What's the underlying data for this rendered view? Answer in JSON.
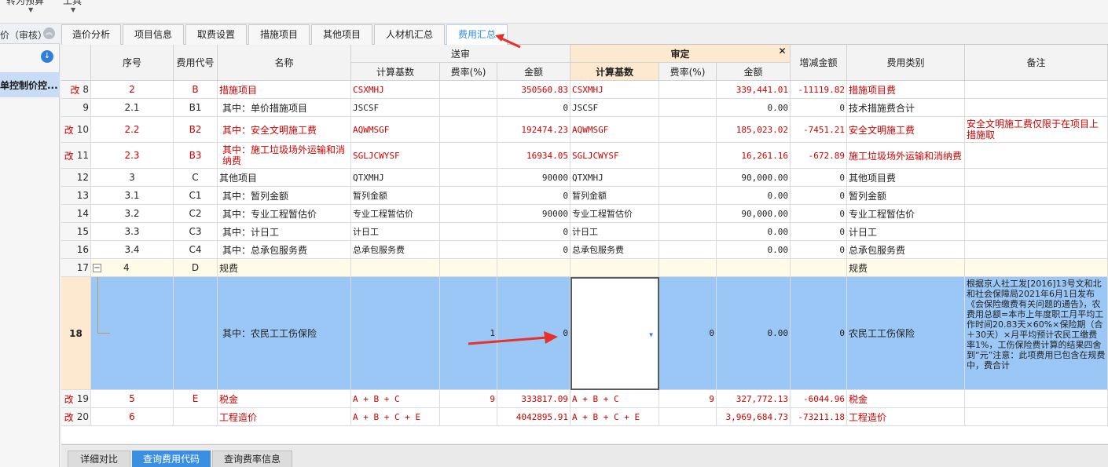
{
  "toolbar": {
    "btn1_label": "转为预算",
    "btn2_label": "工具"
  },
  "left_panel": {
    "header": "价（审核）",
    "item": "单控制价控..."
  },
  "tabs": [
    {
      "label": "造价分析"
    },
    {
      "label": "项目信息"
    },
    {
      "label": "取费设置"
    },
    {
      "label": "措施项目"
    },
    {
      "label": "其他项目"
    },
    {
      "label": "人材机汇总"
    },
    {
      "label": "费用汇总"
    }
  ],
  "grid": {
    "headers": {
      "seq": "序号",
      "code": "费用代号",
      "name": "名称",
      "songshen": "送审",
      "shending": "审定",
      "base": "计算基数",
      "rate": "费率(%)",
      "amount": "金额",
      "diff": "增减金额",
      "category": "费用类别",
      "remark": "备注",
      "close": "✕"
    },
    "modified_mark": "改",
    "rows": [
      {
        "rownum": "8",
        "mod": true,
        "seq": "2",
        "code": "B",
        "name": "措施项目",
        "s_base": "CSXMHJ",
        "s_rate": "",
        "s_amount": "350560.83",
        "d_base": "CSXMHJ",
        "d_rate": "",
        "d_amount": "339,441.01",
        "diff": "-11119.82",
        "category": "措施项目费",
        "remark": ""
      },
      {
        "rownum": "9",
        "mod": false,
        "seq": "2.1",
        "code": "B1",
        "name": "其中：单价措施项目",
        "s_base": "JSCSF",
        "s_rate": "",
        "s_amount": "0",
        "d_base": "JSCSF",
        "d_rate": "",
        "d_amount": "0.00",
        "diff": "0",
        "category": "技术措施费合计",
        "remark": ""
      },
      {
        "rownum": "10",
        "mod": true,
        "seq": "2.2",
        "code": "B2",
        "name": "其中：安全文明施工费",
        "s_base": "AQWMSGF",
        "s_rate": "",
        "s_amount": "192474.23",
        "d_base": "AQWMSGF",
        "d_rate": "",
        "d_amount": "185,023.02",
        "diff": "-7451.21",
        "category": "安全文明施工费",
        "remark": "安全文明施工费仅限于在项目上措施取"
      },
      {
        "rownum": "11",
        "mod": true,
        "seq": "2.3",
        "code": "B3",
        "name": "其中：施工垃圾场外运输和消纳费",
        "s_base": "SGLJCWYSF",
        "s_rate": "",
        "s_amount": "16934.05",
        "d_base": "SGLJCWYSF",
        "d_rate": "",
        "d_amount": "16,261.16",
        "diff": "-672.89",
        "category": "施工垃圾场外运输和消纳费",
        "remark": ""
      },
      {
        "rownum": "12",
        "mod": false,
        "seq": "3",
        "code": "C",
        "name": "其他项目",
        "s_base": "QTXMHJ",
        "s_rate": "",
        "s_amount": "90000",
        "d_base": "QTXMHJ",
        "d_rate": "",
        "d_amount": "90,000.00",
        "diff": "0",
        "category": "其他项目费",
        "remark": ""
      },
      {
        "rownum": "13",
        "mod": false,
        "seq": "3.1",
        "code": "C1",
        "name": "其中：暂列金额",
        "s_base": "暂列金额",
        "s_rate": "",
        "s_amount": "0",
        "d_base": "暂列金额",
        "d_rate": "",
        "d_amount": "0.00",
        "diff": "0",
        "category": "暂列金额",
        "remark": ""
      },
      {
        "rownum": "14",
        "mod": false,
        "seq": "3.2",
        "code": "C2",
        "name": "其中：专业工程暂估价",
        "s_base": "专业工程暂估价",
        "s_rate": "",
        "s_amount": "90000",
        "d_base": "专业工程暂估价",
        "d_rate": "",
        "d_amount": "90,000.00",
        "diff": "0",
        "category": "专业工程暂估价",
        "remark": ""
      },
      {
        "rownum": "15",
        "mod": false,
        "seq": "3.3",
        "code": "C3",
        "name": "其中：计日工",
        "s_base": "计日工",
        "s_rate": "",
        "s_amount": "0",
        "d_base": "计日工",
        "d_rate": "",
        "d_amount": "0.00",
        "diff": "0",
        "category": "计日工",
        "remark": ""
      },
      {
        "rownum": "16",
        "mod": false,
        "seq": "3.4",
        "code": "C4",
        "name": "其中：总承包服务费",
        "s_base": "总承包服务费",
        "s_rate": "",
        "s_amount": "0",
        "d_base": "总承包服务费",
        "d_rate": "",
        "d_amount": "0.00",
        "diff": "0",
        "category": "总承包服务费",
        "remark": ""
      },
      {
        "rownum": "17",
        "mod": false,
        "seq": "4",
        "code": "D",
        "name": "规费",
        "s_base": "",
        "s_rate": "",
        "s_amount": "",
        "d_base": "",
        "d_rate": "",
        "d_amount": "",
        "diff": "",
        "category": "规费",
        "remark": ""
      },
      {
        "rownum": "18",
        "mod": false,
        "seq": "",
        "code": "",
        "name": "其中：农民工工伤保险",
        "s_base": "",
        "s_rate": "1",
        "s_amount": "0",
        "d_base": "",
        "d_rate": "0",
        "d_amount": "0.00",
        "diff": "0",
        "category": "农民工工伤保险",
        "remark": "根据京人社工发[2016]13号文和北和社会保障局2021年6月1日发布《会保险缴费有关问题的通告》，农费用总额=本市上年度职工月平均工作时间20.83天×60%×保险期（合＋30天）×月平均预计农民工缴费率1%，工伤保险费计算的结果四舍到“元”注意：此项费用已包含在规费中，费合计"
      },
      {
        "rownum": "19",
        "mod": true,
        "seq": "5",
        "code": "E",
        "name": "税金",
        "s_base": "A + B + C",
        "s_rate": "9",
        "s_amount": "333817.09",
        "d_base": "A + B + C",
        "d_rate": "9",
        "d_amount": "327,772.13",
        "diff": "-6044.96",
        "category": "税金",
        "remark": ""
      },
      {
        "rownum": "20",
        "mod": true,
        "seq": "6",
        "code": "",
        "name": "工程造价",
        "s_base": "A + B + C + E",
        "s_rate": "",
        "s_amount": "4042895.91",
        "d_base": "A + B + C + E",
        "d_rate": "",
        "d_amount": "3,969,684.73",
        "diff": "-73211.18",
        "category": "工程造价",
        "remark": ""
      }
    ]
  },
  "bottom_tabs": [
    {
      "label": "详细对比"
    },
    {
      "label": "查询费用代码"
    },
    {
      "label": "查询费率信息"
    }
  ],
  "colors": {
    "accent": "#2f8de4",
    "modified_red": "#d40000",
    "selection": "#9ac7f5",
    "shending_header": "#fde9cf",
    "annotation_arrow": "#e8312a"
  }
}
